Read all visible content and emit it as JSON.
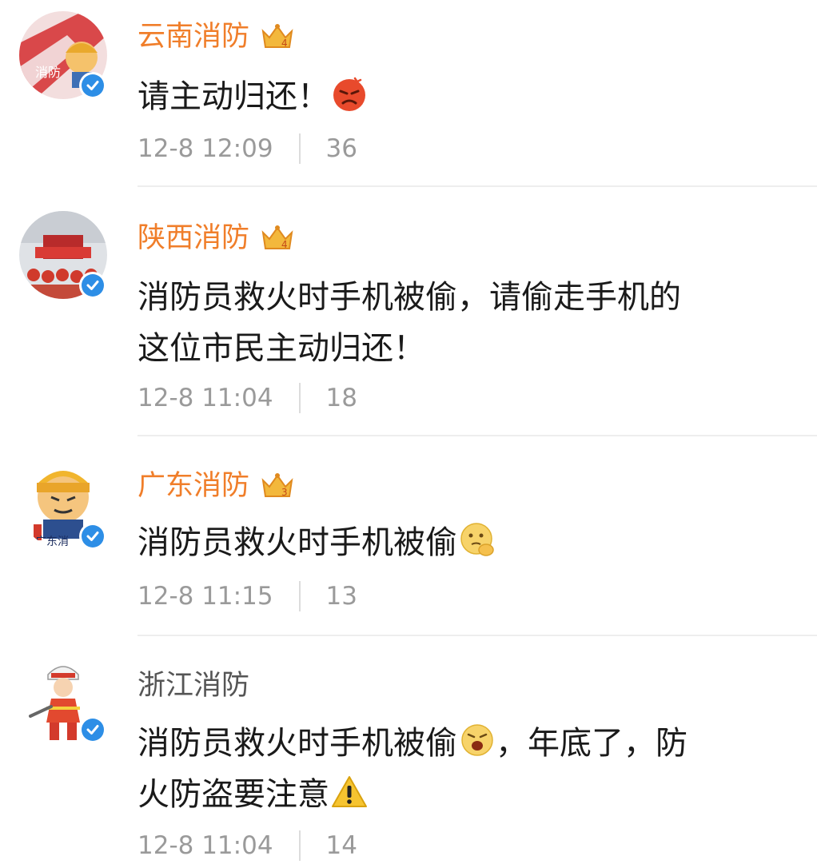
{
  "comments": [
    {
      "author": "云南消防",
      "text": "请主动归还！",
      "time": "12-8 12:09",
      "likes": "36",
      "vip_level": "4",
      "avatar_text": "消防"
    },
    {
      "author": "陕西消防",
      "text_line1": "消防员救火时手机被偷，请偷走手机的",
      "text_line2": "这位市民主动归还！",
      "time": "12-8 11:04",
      "likes": "18",
      "vip_level": "4"
    },
    {
      "author": "广东消防",
      "text": "消防员救火时手机被偷",
      "time": "12-8 11:15",
      "likes": "13",
      "vip_level": "3",
      "avatar_text": "广东消"
    },
    {
      "author": "浙江消防",
      "text_part1": "消防员救火时手机被偷",
      "text_part2": "，年底了，防",
      "text_line2": "火防盗要注意",
      "time": "12-8 11:04",
      "likes": "14"
    }
  ],
  "colors": {
    "vip_name": "#f07e2a",
    "plain_name": "#555555",
    "meta": "#9a9a9a",
    "verified": "#2d8ee6"
  },
  "icons": {
    "verified": "verified-badge-icon",
    "crown": "vip-crown-icon",
    "angry": "angry-face-emoji",
    "thinking": "thinking-face-emoji",
    "shouting": "shouting-face-emoji",
    "warning": "warning-sign-emoji"
  }
}
